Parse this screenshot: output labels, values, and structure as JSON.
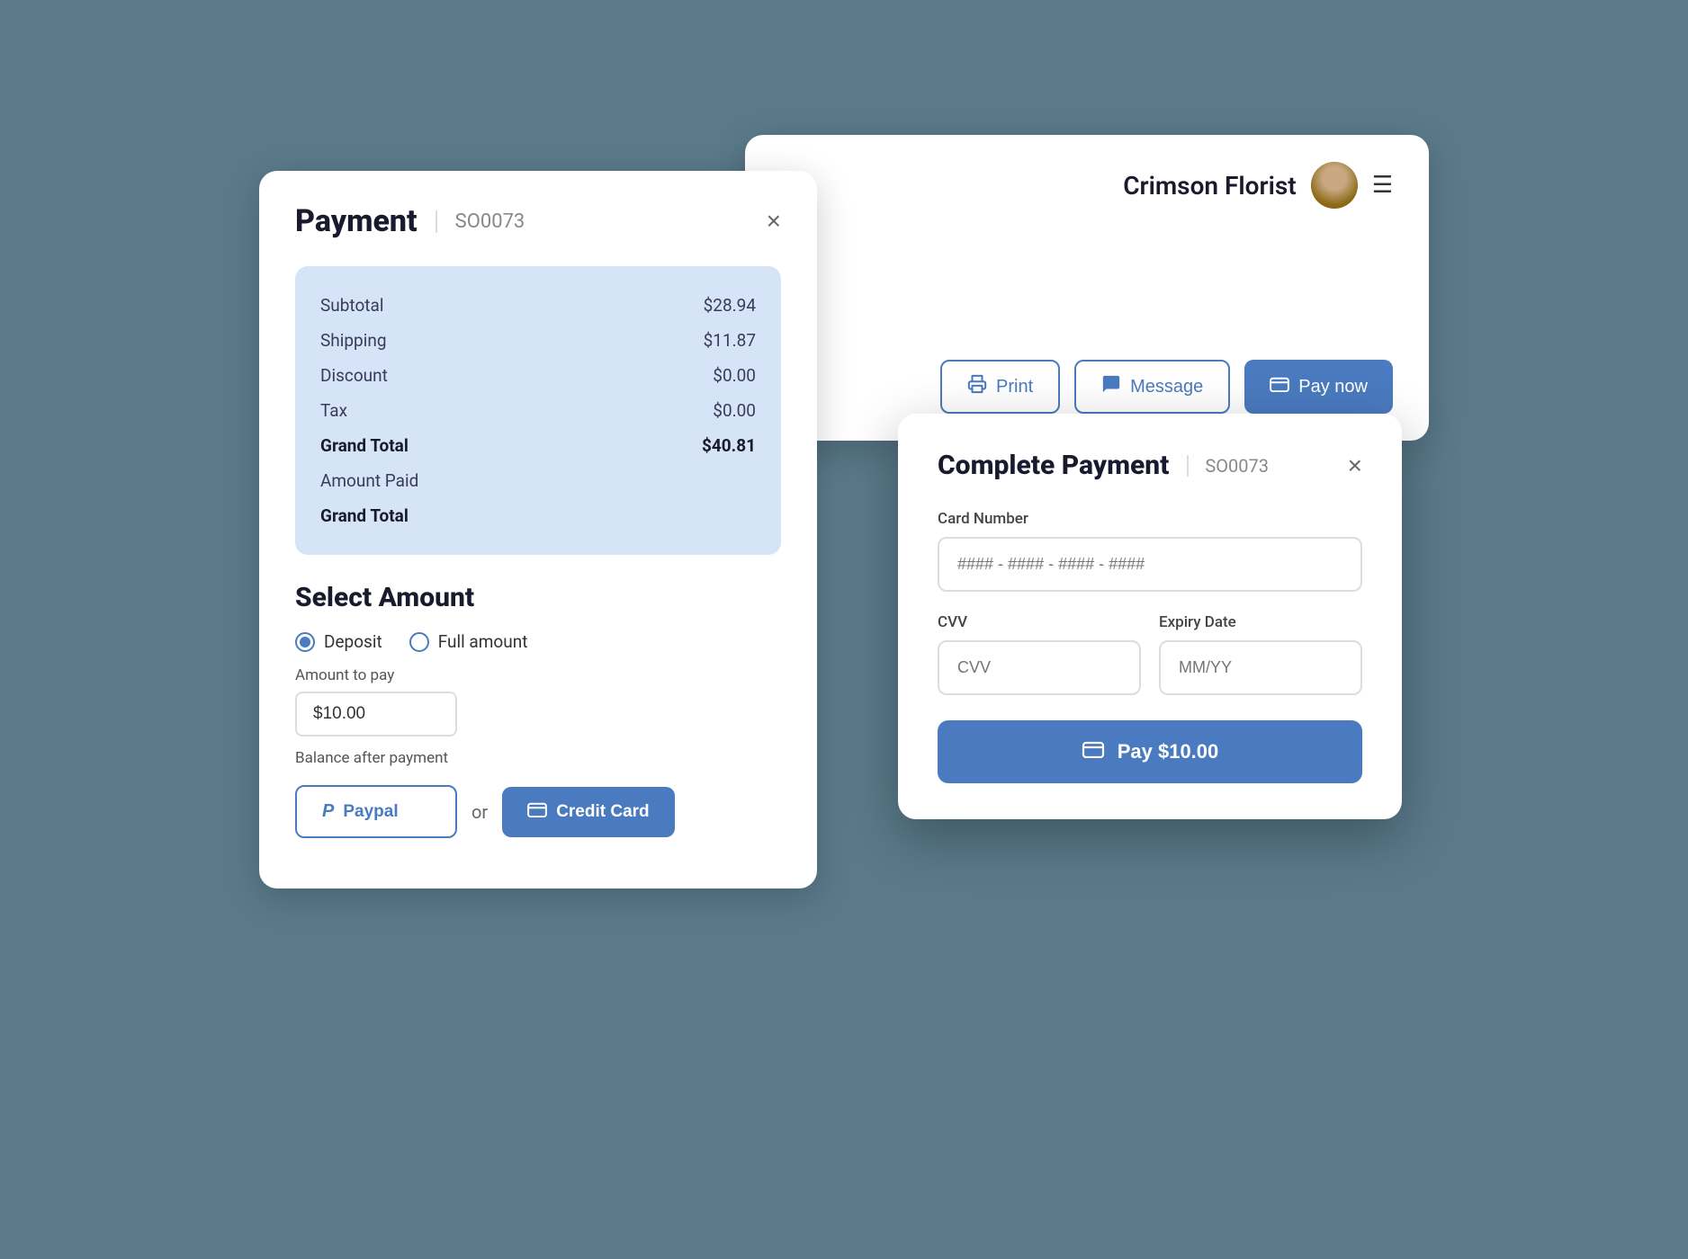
{
  "background": {
    "florist_card": {
      "florist_name": "Crimson Florist",
      "print_label": "Print",
      "message_label": "Message",
      "pay_now_label": "Pay now"
    }
  },
  "payment_card": {
    "title": "Payment",
    "order_id": "SO0073",
    "close_label": "×",
    "summary": {
      "rows": [
        {
          "label": "Subtotal",
          "value": "$28.94"
        },
        {
          "label": "Shipping",
          "value": "$11.87"
        },
        {
          "label": "Discount",
          "value": "$0.00"
        },
        {
          "label": "Tax",
          "value": "$0.00"
        },
        {
          "label": "Grand Total",
          "value": "$40.81",
          "bold": true
        },
        {
          "label": "Amount Paid",
          "value": ""
        },
        {
          "label": "Grand Total",
          "value": "",
          "bold": true
        }
      ]
    },
    "select_amount": {
      "title": "Select Amount",
      "deposit_label": "Deposit",
      "full_amount_label": "Full amount",
      "amount_to_pay_label": "Amount to pay",
      "amount_value": "$10.00",
      "balance_label": "Balance after payment"
    },
    "payment_methods": {
      "paypal_label": "Paypal",
      "or_label": "or",
      "credit_card_label": "Credit Card"
    }
  },
  "complete_payment": {
    "title": "Complete Payment",
    "order_id": "SO0073",
    "close_label": "×",
    "card_number_label": "Card Number",
    "card_number_placeholder": "#### - #### - #### - ####",
    "cvv_label": "CVV",
    "cvv_placeholder": "CVV",
    "expiry_label": "Expiry Date",
    "expiry_placeholder": "MM/YY",
    "pay_button_label": "Pay $10.00"
  }
}
